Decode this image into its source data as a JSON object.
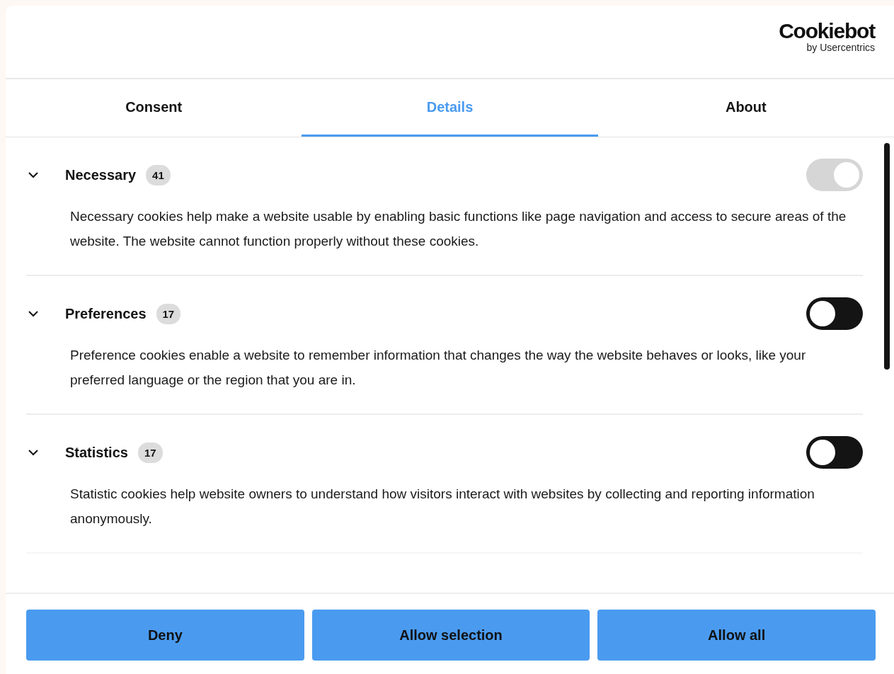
{
  "logo": {
    "name": "Cookiebot",
    "byline": "by Usercentrics"
  },
  "tabs": [
    {
      "label": "Consent",
      "selected": false
    },
    {
      "label": "Details",
      "selected": true
    },
    {
      "label": "About",
      "selected": false
    }
  ],
  "categories": [
    {
      "name": "Necessary",
      "count": "41",
      "expanded": true,
      "on": true,
      "disabled": true,
      "description": "Necessary cookies help make a website usable by enabling basic functions like page navigation and access to secure areas of the website. The website cannot function properly without these cookies."
    },
    {
      "name": "Preferences",
      "count": "17",
      "expanded": true,
      "on": false,
      "disabled": false,
      "description": "Preference cookies enable a website to remember information that changes the way the website behaves or looks, like your preferred language or the region that you are in."
    },
    {
      "name": "Statistics",
      "count": "17",
      "expanded": true,
      "on": false,
      "disabled": false,
      "description": "Statistic cookies help website owners to understand how visitors interact with websites by collecting and reporting information anonymously."
    }
  ],
  "buttons": [
    "Deny",
    "Allow selection",
    "Allow all"
  ]
}
